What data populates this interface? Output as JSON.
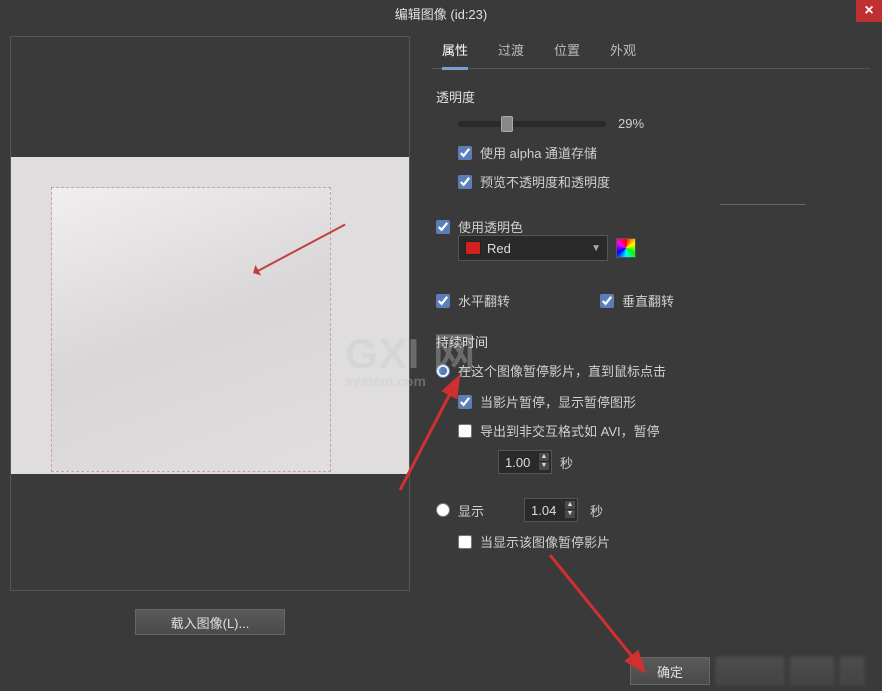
{
  "title": "编辑图像 (id:23)",
  "tabs": {
    "attr": "属性",
    "transition": "过渡",
    "position": "位置",
    "appearance": "外观"
  },
  "opacity": {
    "label": "透明度",
    "value": "29%",
    "percent": 29
  },
  "alpha_store": "使用 alpha 通道存储",
  "preview_opacity": "预览不透明度和透明度",
  "use_trans_color": "使用透明色",
  "color": {
    "name": "Red",
    "hex": "#d02020"
  },
  "flip_h": "水平翻转",
  "flip_v": "垂直翻转",
  "duration": {
    "label": "持续时间"
  },
  "pause_radio": "在这个图像暂停影片，直到鼠标点击",
  "pause_sub1": "当影片暂停，显示暂停图形",
  "pause_sub2": "导出到非交互格式如 AVI，暂停",
  "pause_seconds": "1.00",
  "seconds_label": "秒",
  "display_radio": "显示",
  "display_seconds": "1.04",
  "display_sub": "当显示该图像暂停影片",
  "load_image": "载入图像(L)...",
  "ok": "确定",
  "watermark": "GXI 网",
  "watermark_sub": "system.com"
}
